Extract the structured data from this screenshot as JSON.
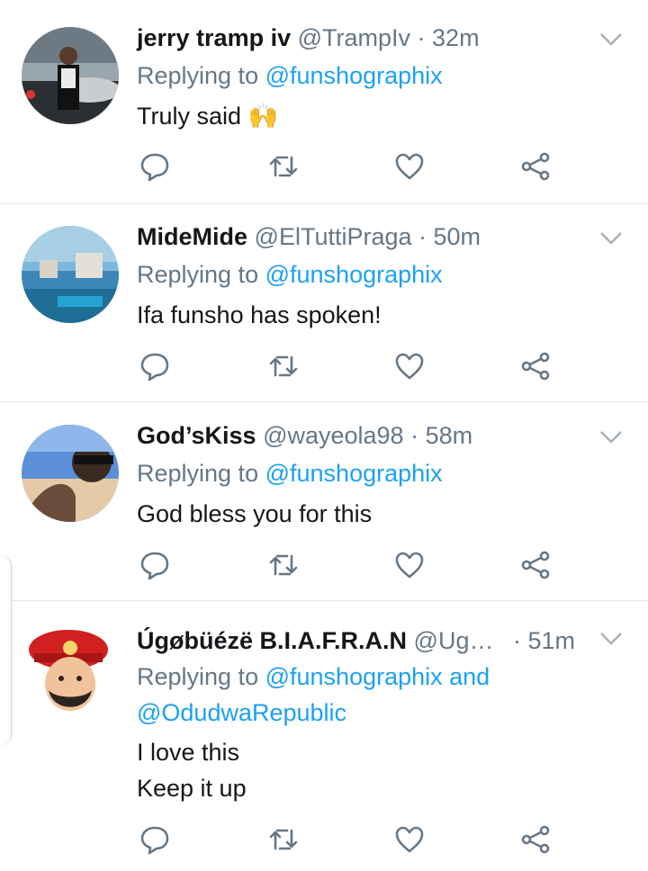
{
  "tweets": [
    {
      "name": "jerry tramp iv",
      "handle": "@TrampIv",
      "time": "· 32m",
      "replying_prefix": "Replying to",
      "replying_to": "@funshographix",
      "replying_to_2": "",
      "text": "Truly said 🙌"
    },
    {
      "name": "MideMide",
      "handle": "@ElTuttiPraga",
      "time": "· 50m",
      "replying_prefix": "Replying to",
      "replying_to": "@funshographix",
      "replying_to_2": "",
      "text": "Ifa funsho has spoken!"
    },
    {
      "name": "God’sKiss",
      "handle": "@wayeola98",
      "time": "· 58m",
      "replying_prefix": "Replying to",
      "replying_to": "@funshographix",
      "replying_to_2": "",
      "text": "God bless you for this"
    },
    {
      "name": "Úgøbüézë B.I.A.F.R.A.N",
      "handle": "@Ug…",
      "time": "· 51m",
      "replying_prefix": "Replying to",
      "replying_to": "@funshographix and",
      "replying_to_2": "@OdudwaRepublic",
      "text": "I love this\nKeep it up"
    }
  ],
  "colors": {
    "name": "#14171a",
    "meta": "#657786",
    "link": "#1da1f2",
    "icon": "#657786",
    "divider": "#e1e8ed"
  },
  "icons": [
    "chevron-down-icon",
    "reply-icon",
    "retweet-icon",
    "like-icon",
    "share-icon"
  ]
}
